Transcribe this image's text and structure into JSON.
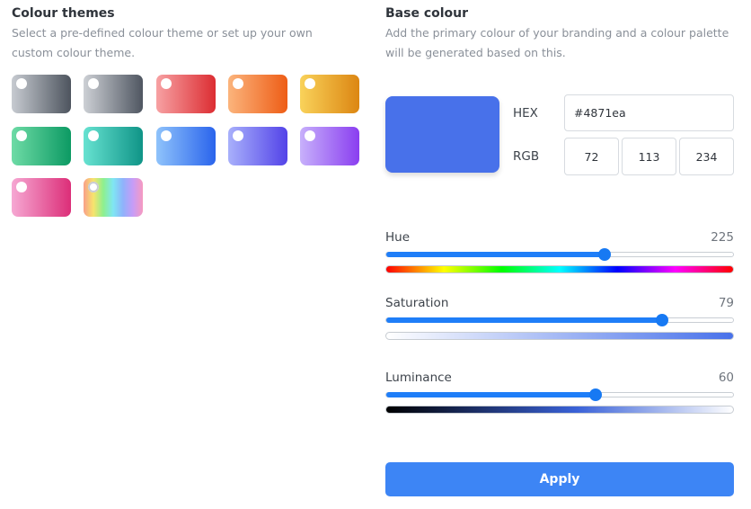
{
  "themes": {
    "title": "Colour themes",
    "description": "Select a pre-defined colour theme or set up your own custom colour theme.",
    "swatches": [
      {
        "name": "slate",
        "from": "#c7cbd1",
        "to": "#4d545e"
      },
      {
        "name": "grey",
        "from": "#cdd0d5",
        "to": "#4f5661"
      },
      {
        "name": "red",
        "from": "#f7a1a3",
        "to": "#dc2d32"
      },
      {
        "name": "orange",
        "from": "#fbb47c",
        "to": "#ee5d16"
      },
      {
        "name": "amber",
        "from": "#f9d25a",
        "to": "#dc8612"
      },
      {
        "name": "green",
        "from": "#6edba6",
        "to": "#0c9a63"
      },
      {
        "name": "teal",
        "from": "#67e2d1",
        "to": "#0f9487"
      },
      {
        "name": "blue",
        "from": "#8fc3fb",
        "to": "#2a64ec"
      },
      {
        "name": "indigo",
        "from": "#a8b0fb",
        "to": "#5343e8"
      },
      {
        "name": "purple",
        "from": "#c7b0fb",
        "to": "#8a3ef0"
      },
      {
        "name": "pink",
        "from": "#f6a8d3",
        "to": "#dc2e78"
      },
      {
        "name": "rainbow",
        "from": "",
        "to": ""
      }
    ]
  },
  "base": {
    "title": "Base colour",
    "description": "Add the primary colour of your branding and a colour palette will be generated based on this.",
    "preview_color": "#4871ea",
    "hex_label": "HEX",
    "hex_value": "#4871ea",
    "rgb_label": "RGB",
    "r": "72",
    "g": "113",
    "b": "234"
  },
  "sliders": {
    "hue": {
      "label": "Hue",
      "value": 225,
      "max": 360,
      "display": "225"
    },
    "saturation": {
      "label": "Saturation",
      "value": 79,
      "max": 100,
      "display": "79"
    },
    "luminance": {
      "label": "Luminance",
      "value": 60,
      "max": 100,
      "display": "60"
    }
  },
  "apply_label": "Apply"
}
